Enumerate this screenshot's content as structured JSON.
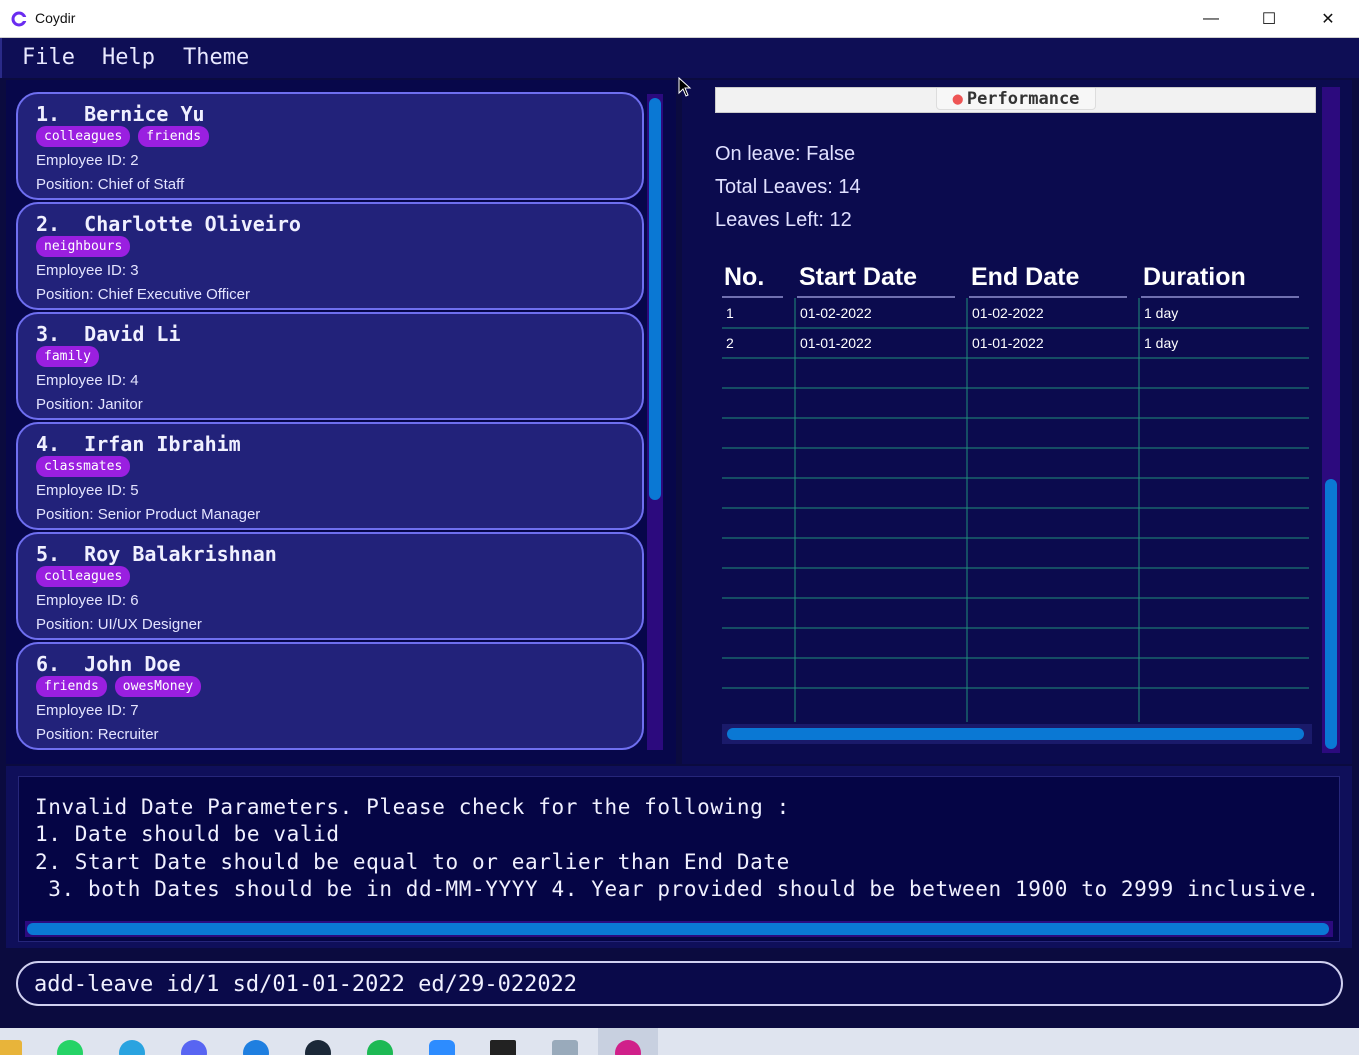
{
  "window": {
    "title": "Coydir",
    "minimize_glyph": "—",
    "maximize_glyph": "☐",
    "close_glyph": "✕"
  },
  "menu": {
    "file": "File",
    "help": "Help",
    "theme": "Theme"
  },
  "employees": [
    {
      "name": "1.  Bernice Yu",
      "tags": [
        "colleagues",
        "friends"
      ],
      "id_line": "Employee ID:  2",
      "position_line": "Position:  Chief of Staff"
    },
    {
      "name": "2.  Charlotte Oliveiro",
      "tags": [
        "neighbours"
      ],
      "id_line": "Employee ID:  3",
      "position_line": "Position:  Chief Executive Officer"
    },
    {
      "name": "3.  David Li",
      "tags": [
        "family"
      ],
      "id_line": "Employee ID:  4",
      "position_line": "Position:  Janitor"
    },
    {
      "name": "4.  Irfan Ibrahim",
      "tags": [
        "classmates"
      ],
      "id_line": "Employee ID:  5",
      "position_line": "Position:  Senior Product Manager"
    },
    {
      "name": "5.  Roy Balakrishnan",
      "tags": [
        "colleagues"
      ],
      "id_line": "Employee ID:  6",
      "position_line": "Position:  UI/UX Designer"
    },
    {
      "name": "6.  John Doe",
      "tags": [
        "friends",
        "owesMoney"
      ],
      "id_line": "Employee ID:  7",
      "position_line": "Position:  Recruiter"
    }
  ],
  "details": {
    "performance_label": "Performance",
    "on_leave": "On leave: False",
    "total_leaves": "Total Leaves: 14",
    "leaves_left": "Leaves Left: 12"
  },
  "leave_table": {
    "headers": [
      "No.",
      "Start Date",
      "End Date",
      "Duration"
    ],
    "rows": [
      [
        "1",
        "01-02-2022",
        "01-02-2022",
        "1 day"
      ],
      [
        "2",
        "01-01-2022",
        "01-01-2022",
        "1 day"
      ]
    ]
  },
  "result": {
    "lines": [
      "Invalid Date Parameters. Please check for the following :",
      "1. Date should be valid",
      "2. Start Date should be equal to or earlier than End Date",
      " 3. both Dates should be in dd-MM-YYYY 4. Year provided should be between 1900 to 2999 inclusive."
    ]
  },
  "command": {
    "value": "add-leave id/1 sd/01-01-2022 ed/29-022022"
  },
  "taskbar": {
    "icons": [
      "folder-icon",
      "whatsapp-icon",
      "telegram-icon",
      "discord-icon",
      "app-store-icon",
      "steam-icon",
      "spotify-icon",
      "zoom-icon",
      "terminal-icon",
      "notepad-icon",
      "coydir-icon"
    ]
  },
  "colors": {
    "accent": "#0a78d4",
    "tag": "#9a1fe0",
    "card": "#22227a",
    "background": "#0b0b3f"
  }
}
